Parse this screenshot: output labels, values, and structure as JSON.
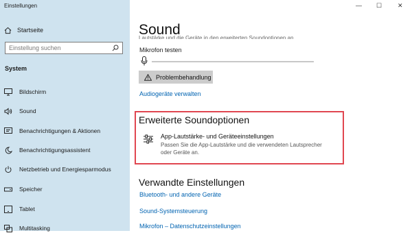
{
  "window": {
    "title": "Einstellungen",
    "controls": {
      "minimize": "—",
      "maximize": "☐",
      "close": "✕"
    }
  },
  "sidebar": {
    "home": "Startseite",
    "search_placeholder": "Einstellung suchen",
    "section": "System",
    "items": [
      {
        "label": "Bildschirm",
        "icon": "monitor-icon"
      },
      {
        "label": "Sound",
        "icon": "speaker-icon"
      },
      {
        "label": "Benachrichtigungen & Aktionen",
        "icon": "notification-icon"
      },
      {
        "label": "Benachrichtigungsassistent",
        "icon": "moon-icon"
      },
      {
        "label": "Netzbetrieb und Energiesparmodus",
        "icon": "power-icon"
      },
      {
        "label": "Speicher",
        "icon": "storage-icon"
      },
      {
        "label": "Tablet",
        "icon": "tablet-icon"
      },
      {
        "label": "Multitasking",
        "icon": "multitasking-icon"
      }
    ]
  },
  "main": {
    "title": "Sound",
    "cut_text": "Lautstärke und die Geräte in den erweiterten Soundoptionen an.",
    "mic_label": "Mikrofon testen",
    "troubleshoot_button": "Problembehandlung",
    "manage_devices_link": "Audiogeräte verwalten",
    "advanced": {
      "heading": "Erweiterte Soundoptionen",
      "item_title": "App-Lautstärke- und Geräteeinstellungen",
      "item_desc": "Passen Sie die App-Lautstärke und die verwendeten Lautsprecher oder Geräte an."
    },
    "related": {
      "heading": "Verwandte Einstellungen",
      "links": [
        "Bluetooth- und andere Geräte",
        "Sound-Systemsteuerung",
        "Mikrofon – Datenschutzeinstellungen"
      ]
    }
  },
  "colors": {
    "sidebar_bg": "#cfe3ef",
    "link": "#0063b1",
    "highlight": "#e0454f"
  }
}
